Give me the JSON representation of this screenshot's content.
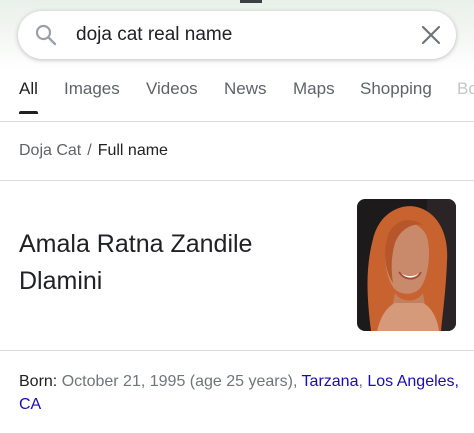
{
  "search": {
    "query": "doja cat real name",
    "icon": "search-icon",
    "clear_icon": "close-icon"
  },
  "tabs": [
    {
      "label": "All",
      "active": true
    },
    {
      "label": "Images"
    },
    {
      "label": "Videos"
    },
    {
      "label": "News"
    },
    {
      "label": "Maps"
    },
    {
      "label": "Shopping"
    },
    {
      "label": "Bo"
    }
  ],
  "breadcrumb": {
    "entity": "Doja Cat",
    "separator": "/",
    "attribute": "Full name"
  },
  "answer": {
    "line1": "Amala Ratna Zandile",
    "line2": "Dlamini"
  },
  "born": {
    "label": "Born:",
    "text": " October 21, 1995 (age 25 years), ",
    "place_city": "Tarzana",
    "place_sep": ", ",
    "place_region": "Los Angeles, CA"
  },
  "colors": {
    "link": "#1a0dab",
    "secondary_text": "#70757a",
    "primary_text": "#202124",
    "divider": "#dadce0"
  }
}
